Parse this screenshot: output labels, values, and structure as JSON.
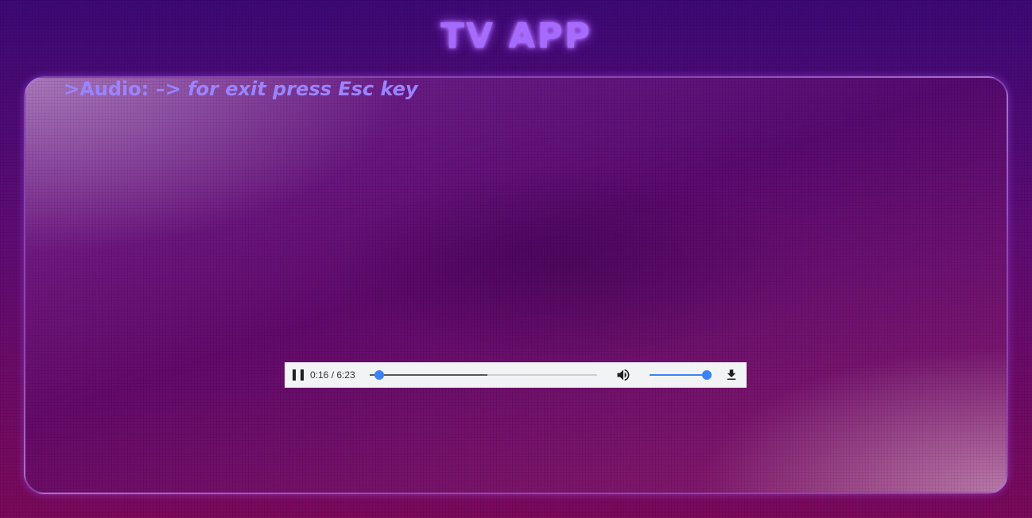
{
  "app": {
    "title": "TV APP"
  },
  "panel": {
    "caption_prefix": ">Audio: –> ",
    "caption_hint": "for exit press Esc key"
  },
  "audio_player": {
    "state": "playing",
    "current_time": "0:16",
    "duration": "6:23",
    "time_display": "0:16 / 6:23",
    "progress_fraction": 0.042,
    "buffered_fraction": 0.52,
    "volume_fraction": 1.0,
    "icons": [
      "pause-icon",
      "volume-icon",
      "download-icon"
    ]
  },
  "colors": {
    "title": "#a56bff",
    "caption": "#9b84ff",
    "player_background": "#f1f3f4",
    "slider_accent": "#3b82f6"
  }
}
